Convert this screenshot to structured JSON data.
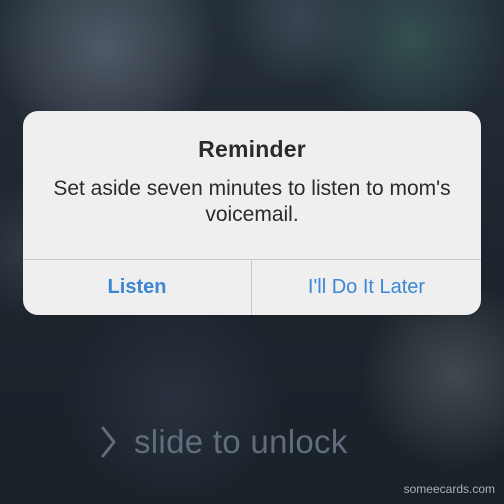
{
  "alert": {
    "title": "Reminder",
    "message": "Set aside seven minutes to listen to mom's voicemail.",
    "buttons": {
      "primary": "Listen",
      "secondary": "I'll Do It Later"
    },
    "button_color": "#3c86d6"
  },
  "lock_screen": {
    "slide_text": "slide to unlock",
    "chevron_icon": "chevron-right-icon"
  },
  "watermark": "someecards.com"
}
